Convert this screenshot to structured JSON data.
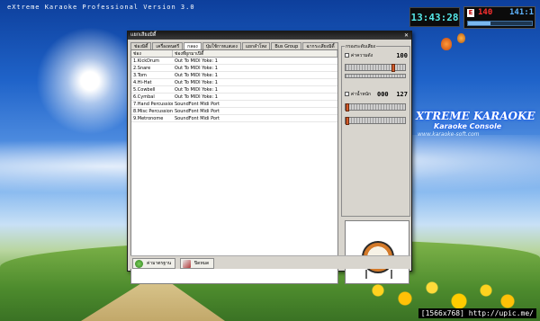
{
  "app": {
    "title": "eXtreme Karaoke Professional Version 3.0"
  },
  "hud": {
    "clock": "13:43:28",
    "badge": "E",
    "bpm": "140",
    "position": "141:1",
    "progress": 0.35
  },
  "branding": {
    "name": "XTREME KARAOKE",
    "subtitle": "Karaoke Console",
    "url": "www.karaoke-soft.com"
  },
  "dialog": {
    "title": "แยกเสียงมิดี้",
    "tabs": [
      {
        "label": "ช่องมิดี้"
      },
      {
        "label": "เครื่องดนตรี"
      },
      {
        "label": "กลอง"
      },
      {
        "label": "ปุ่มใช้กาหแสเดง"
      },
      {
        "label": "แยกลำโพง"
      },
      {
        "label": "Bus Group"
      },
      {
        "label": "ฉากระเสียงมิดี้"
      }
    ],
    "table": {
      "columns": [
        "ช่อง",
        "ช่องที่ผูกมาเปิดี้"
      ],
      "rows": [
        {
          "name": "1.KickDrum",
          "port": "Out To MIDI Yoke:  1"
        },
        {
          "name": "2.Snare",
          "port": "Out To MIDI Yoke:  1"
        },
        {
          "name": "3.Tom",
          "port": "Out To MIDI Yoke:  1"
        },
        {
          "name": "4.Hi-Hat",
          "port": "Out To MIDI Yoke:  1"
        },
        {
          "name": "5.Cowbell",
          "port": "Out To MIDI Yoke:  1"
        },
        {
          "name": "6.Cymbal",
          "port": "Out To MIDI Yoke:  1"
        },
        {
          "name": "7.Hand Percussion",
          "port": "SoundFont Midi Port"
        },
        {
          "name": "8.Misc Percussion",
          "port": "SoundFont Midi Port"
        },
        {
          "name": "9.Metronome",
          "port": "SoundFont Midi Port"
        }
      ]
    },
    "right_panel": {
      "group_label": "กรองระดับเสียง",
      "volume": {
        "label": "ค่าความดัง",
        "value": "100",
        "level": 0.79
      },
      "velocity": {
        "label": "ค่าน้ำหนัก",
        "value_min": "000",
        "value_max": "127"
      }
    },
    "buttons": {
      "default_label": "ค่ามาตรฐาน",
      "close_label": "ปิดหมด"
    }
  },
  "watermark": "[1566x768] http://upic.me/",
  "colors": {
    "dialog_bg": "#d8d5ce",
    "titlebar": "#1a1a1a",
    "clock_text": "#55e6e6",
    "bpm_text": "#ff3030",
    "pos_text": "#5fb4ff"
  }
}
